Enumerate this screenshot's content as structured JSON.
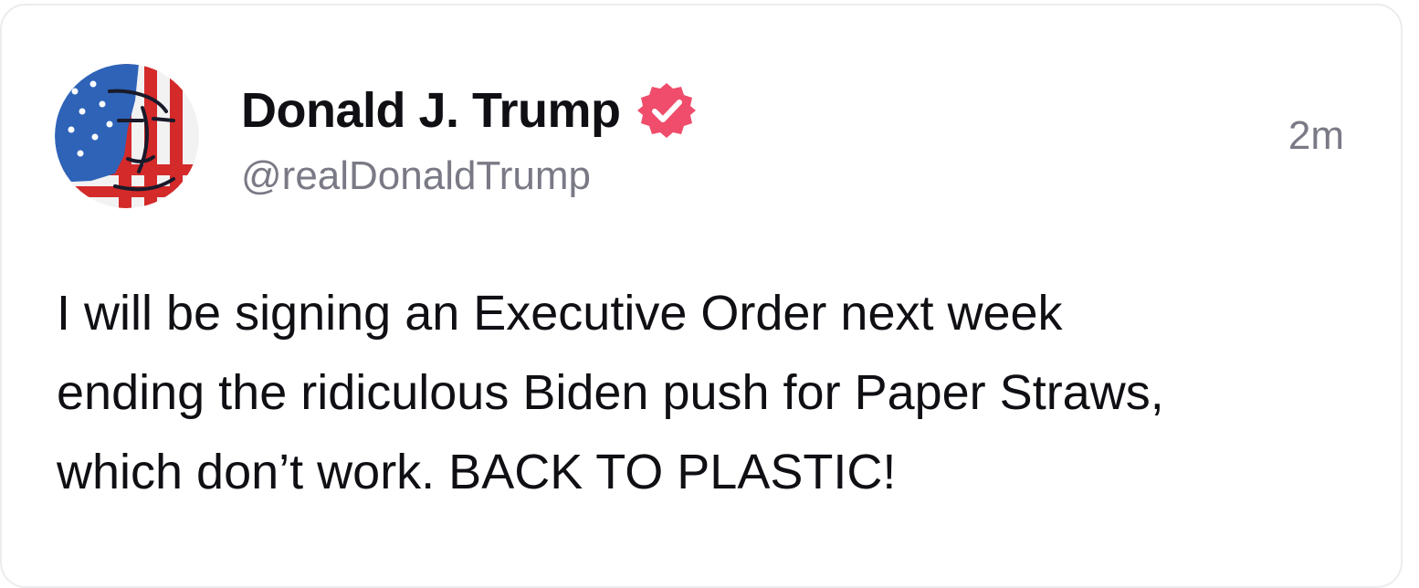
{
  "post": {
    "author_name": "Donald J. Trump",
    "handle": "@realDonaldTrump",
    "timestamp": "2m",
    "verified_icon": "verified-badge-icon",
    "verified_color": "#ef4d6b",
    "avatar": "avatar-image",
    "body_lines": [
      "I will be signing an Executive Order next week",
      "ending the ridiculous Biden push for Paper Straws,",
      "which don’t work. BACK TO PLASTIC!"
    ]
  }
}
